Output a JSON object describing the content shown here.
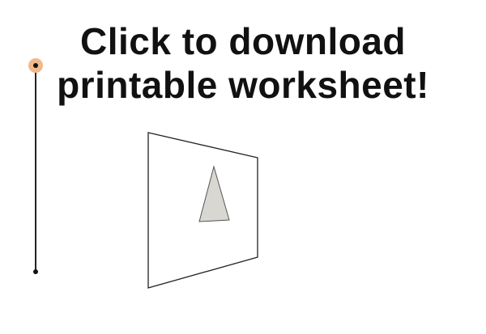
{
  "download_link": {
    "line1": "Click to download",
    "line2": "printable worksheet!"
  },
  "slider": {
    "value": 1.0,
    "handle_color": "#f1b98a"
  },
  "figure": {
    "frame_icon": "trapezoid-frame",
    "shape_icon": "triangle",
    "shape_fill": "#d9d7d2"
  }
}
